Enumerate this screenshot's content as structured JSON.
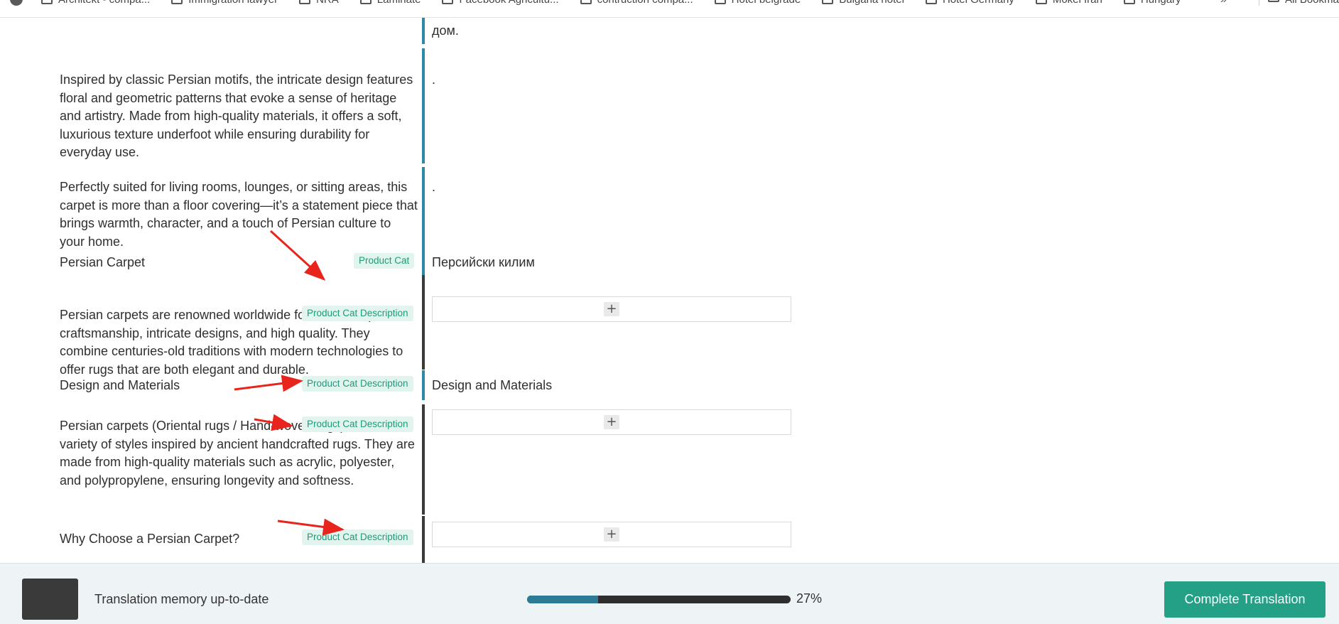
{
  "bookmarks": [
    {
      "label": "Architekt - compa..."
    },
    {
      "label": "Immigration lawyer"
    },
    {
      "label": "NRA"
    },
    {
      "label": "Laminate"
    },
    {
      "label": "Facebook Agricultu..."
    },
    {
      "label": "contruction compa..."
    },
    {
      "label": "Hotel belgrade"
    },
    {
      "label": "Bulgaria hotel"
    },
    {
      "label": "Hotel Germany"
    },
    {
      "label": "Mokei Iran"
    },
    {
      "label": "Hungary"
    }
  ],
  "bookmarks_more": "»",
  "bookmarks_all": "All Bookmarks",
  "rows": [
    {
      "target_text": "дом."
    },
    {
      "source_text": "Inspired by classic Persian motifs, the intricate design features floral and geometric patterns that evoke a sense of heritage and artistry. Made from high-quality materials, it offers a soft, luxurious texture underfoot while ensuring durability for everyday use.",
      "target_text": "."
    },
    {
      "source_text": "Perfectly suited for living rooms, lounges, or sitting areas, this carpet is more than a floor covering—it’s a statement piece that brings warmth, character, and a touch of Persian culture to your home.",
      "target_text": "."
    },
    {
      "source_text": "Persian Carpet",
      "badge": "Product Cat",
      "target_text": "Персийски килим"
    },
    {
      "source_text": "Persian carpets are renowned worldwide for their exceptional craftsmanship, intricate designs, and high quality. They combine centuries-old traditions with modern technologies to offer rugs that are both elegant and durable.",
      "badge": "Product Cat Description",
      "add_button": "+"
    },
    {
      "source_text": "Design and Materials",
      "badge": "Product Cat Description",
      "target_text": "Design and Materials"
    },
    {
      "source_text": "Persian carpets (Oriental rugs / Hand-woven rugs) come in a variety of styles inspired by ancient handcrafted rugs. They are made from high-quality materials such as acrylic, polyester, and polypropylene, ensuring longevity and softness.",
      "badge": "Product Cat Description",
      "add_button": "+"
    },
    {
      "source_text": "Why Choose a Persian Carpet?",
      "badge": "Product Cat Description",
      "add_button": "+"
    }
  ],
  "footer": {
    "memory_status": "Translation memory up-to-date",
    "progress_percent": 27,
    "progress_label": "27%",
    "complete_button": "Complete Translation"
  },
  "colors": {
    "accent_teal": "#23a086",
    "badge_text": "#1f9a78",
    "bar_blue": "#2c8aa6",
    "bar_dark": "#3a3a3a",
    "progress_fill": "#2c7a96",
    "arrow": "#e8241c"
  }
}
